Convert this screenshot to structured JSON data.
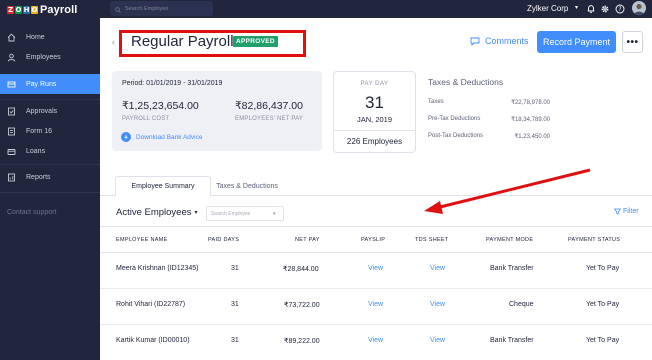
{
  "app": {
    "logo_letters": [
      "Z",
      "O",
      "H",
      "O"
    ],
    "logo_colors": [
      "#e42527",
      "#089949",
      "#226db4",
      "#f9b21d"
    ],
    "name": "Payroll"
  },
  "sidebar": {
    "items": [
      {
        "label": "Home",
        "icon": "home-icon"
      },
      {
        "label": "Employees",
        "icon": "employees-icon"
      },
      {
        "label": "Pay Runs",
        "icon": "pay-runs-icon",
        "active": true
      },
      {
        "label": "Approvals",
        "icon": "approvals-icon"
      },
      {
        "label": "Form 16",
        "icon": "form16-icon"
      },
      {
        "label": "Loans",
        "icon": "loans-icon"
      },
      {
        "label": "Reports",
        "icon": "reports-icon"
      }
    ],
    "contact": "Contact support"
  },
  "topbar": {
    "search_placeholder": "Search Employee",
    "org_name": "Zylker Corp",
    "icons": [
      "bell-icon",
      "gear-icon",
      "help-icon"
    ]
  },
  "header": {
    "back": "‹",
    "title": "Regular Payroll",
    "status": "APPROVED",
    "comments_label": "Comments",
    "record_payment_label": "Record Payment",
    "more": "•••"
  },
  "summary": {
    "period_label": "Period:",
    "period_value": "01/01/2019 - 31/01/2019",
    "payroll_cost": "₹1,25,23,654.00",
    "payroll_cost_label": "PAYROLL COST",
    "net_pay": "₹82,86,437.00",
    "net_pay_label": "EMPLOYEES' NET PAY",
    "download_label": "Download Bank Advice"
  },
  "payday": {
    "label": "PAY DAY",
    "day": "31",
    "month_year": "JAN, 2019",
    "employees": "226 Employees"
  },
  "taxes": {
    "title": "Taxes & Deductions",
    "rows": [
      {
        "label": "Taxes",
        "value": "₹22,78,978.00"
      },
      {
        "label": "Pre-Tax Deductions",
        "value": "₹18,34,789.00"
      },
      {
        "label": "Post-Tax Deductions",
        "value": "₹1,23,450.00"
      }
    ]
  },
  "tabs": {
    "summary": "Employee Summary",
    "taxes": "Taxes & Deductions"
  },
  "filter": {
    "view": "Active Employees",
    "search_placeholder": "Search Employee",
    "filter_label": "Filter"
  },
  "table": {
    "columns": [
      "EMPLOYEE NAME",
      "PAID DAYS",
      "NET PAY",
      "PAYSLIP",
      "TDS SHEET",
      "PAYMENT MODE",
      "PAYMENT STATUS"
    ],
    "rows": [
      {
        "name": "Meera Krishnan (ID12345)",
        "paid_days": "31",
        "net_pay": "₹28,844.00",
        "payslip": "View",
        "tds": "View",
        "mode": "Bank Transfer",
        "status": "Yet To Pay"
      },
      {
        "name": "Rohit Vihari (ID22787)",
        "paid_days": "31",
        "net_pay": "₹73,722.00",
        "payslip": "View",
        "tds": "View",
        "mode": "Cheque",
        "status": "Yet To Pay"
      },
      {
        "name": "Kartik Kumar (ID00010)",
        "paid_days": "31",
        "net_pay": "₹89,222.00",
        "payslip": "View",
        "tds": "View",
        "mode": "Bank Transfer",
        "status": "Yet To Pay"
      }
    ]
  },
  "colors": {
    "sidebar_bg": "#21263c",
    "accent": "#408dfb",
    "approved": "#22a06b",
    "annotation": "#e01010"
  }
}
